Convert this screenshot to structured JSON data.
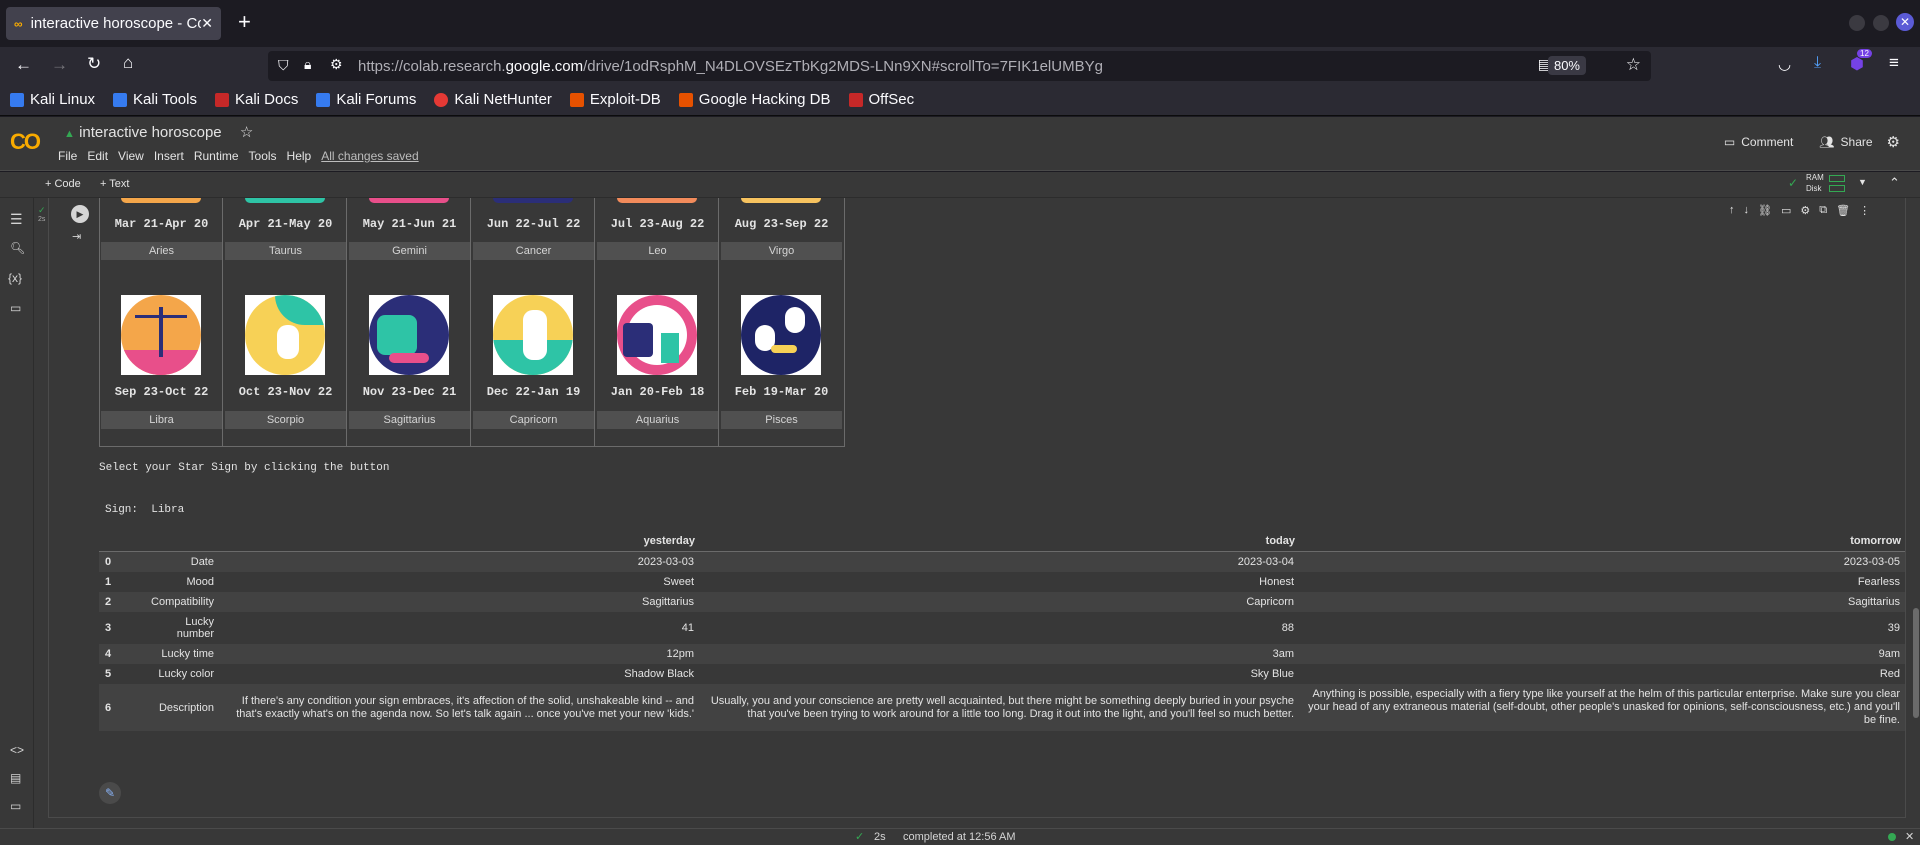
{
  "browser": {
    "tab_title": "interactive horoscope - Co",
    "url_prefix": "https://colab.research.",
    "url_domain": "google.com",
    "url_rest": "/drive/1odRsphM_N4DLOVSEzTbKg2MDS-LNn9XN#scrollTo=7FIK1elUMBYg",
    "zoom": "80%",
    "downloads_badge": "12",
    "bookmarks": [
      "Kali Linux",
      "Kali Tools",
      "Kali Docs",
      "Kali Forums",
      "Kali NetHunter",
      "Exploit-DB",
      "Google Hacking DB",
      "OffSec"
    ]
  },
  "colab": {
    "logo": "CO",
    "notebook_title": "interactive horoscope",
    "menus": [
      "File",
      "Edit",
      "View",
      "Insert",
      "Runtime",
      "Tools",
      "Help"
    ],
    "saved_status": "All changes saved",
    "comment_label": "Comment",
    "share_label": "Share",
    "add_code": "+ Code",
    "add_text": "+ Text",
    "ram_label": "RAM",
    "disk_label": "Disk",
    "exec_time": "2s"
  },
  "zodiac": {
    "row1": [
      {
        "date": "Mar 21-Apr 20",
        "name": "Aries"
      },
      {
        "date": "Apr 21-May 20",
        "name": "Taurus"
      },
      {
        "date": "May 21-Jun 21",
        "name": "Gemini"
      },
      {
        "date": "Jun 22-Jul 22",
        "name": "Cancer"
      },
      {
        "date": "Jul 23-Aug 22",
        "name": "Leo"
      },
      {
        "date": "Aug 23-Sep 22",
        "name": "Virgo"
      }
    ],
    "row2": [
      {
        "date": "Sep 23-Oct 22",
        "name": "Libra"
      },
      {
        "date": "Oct 23-Nov 22",
        "name": "Scorpio"
      },
      {
        "date": "Nov 23-Dec 21",
        "name": "Sagittarius"
      },
      {
        "date": "Dec 22-Jan 19",
        "name": "Capricorn"
      },
      {
        "date": "Jan 20-Feb 18",
        "name": "Aquarius"
      },
      {
        "date": "Feb 19-Mar 20",
        "name": "Pisces"
      }
    ]
  },
  "prompt_text": "Select your Star Sign by clicking the button",
  "sign_label": "Sign:",
  "sign_value": "Libra",
  "table": {
    "headers": [
      "",
      "",
      "yesterday",
      "today",
      "tomorrow"
    ],
    "rows": [
      [
        "0",
        "Date",
        "2023-03-03",
        "2023-03-04",
        "2023-03-05"
      ],
      [
        "1",
        "Mood",
        "Sweet",
        "Honest",
        "Fearless"
      ],
      [
        "2",
        "Compatibility",
        "Sagittarius",
        "Capricorn",
        "Sagittarius"
      ],
      [
        "3",
        "Lucky number",
        "41",
        "88",
        "39"
      ],
      [
        "4",
        "Lucky time",
        "12pm",
        "3am",
        "9am"
      ],
      [
        "5",
        "Lucky color",
        "Shadow Black",
        "Sky Blue",
        "Red"
      ],
      [
        "6",
        "Description",
        "If there's any condition your sign embraces, it's affection of the solid, unshakeable kind -- and that's exactly what's on the agenda now. So let's talk again ... once you've met your new 'kids.'",
        "Usually, you and your conscience are pretty well acquainted, but there might be something deeply buried in your psyche that you've been trying to work around for a little too long. Drag it out into the light, and you'll feel so much better.",
        "Anything is possible, especially with a fiery type like yourself at the helm of this particular enterprise. Make sure you clear your head of any extraneous material (self-doubt, other people's unasked for opinions, self-consciousness, etc.) and you'll be fine."
      ]
    ]
  },
  "status": {
    "time": "2s",
    "message": "completed at 12:56 AM"
  }
}
